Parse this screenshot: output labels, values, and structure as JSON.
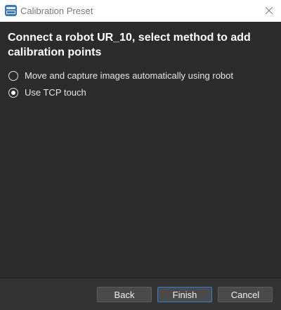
{
  "window": {
    "title": "Calibration Preset",
    "app_icon": "app-logo-icon",
    "close_icon": "close-icon"
  },
  "main": {
    "heading": "Connect a robot UR_10, select method to add calibration points",
    "options": [
      {
        "label": "Move and capture images automatically using robot",
        "selected": false
      },
      {
        "label": "Use TCP touch",
        "selected": true
      }
    ]
  },
  "footer": {
    "back_label": "Back",
    "finish_label": "Finish",
    "cancel_label": "Cancel",
    "focused_button": "Finish"
  },
  "colors": {
    "background": "#2b2b2b",
    "titlebar": "#ffffff",
    "focus_border": "#2f7fd6",
    "button": "#4a4a4a"
  }
}
